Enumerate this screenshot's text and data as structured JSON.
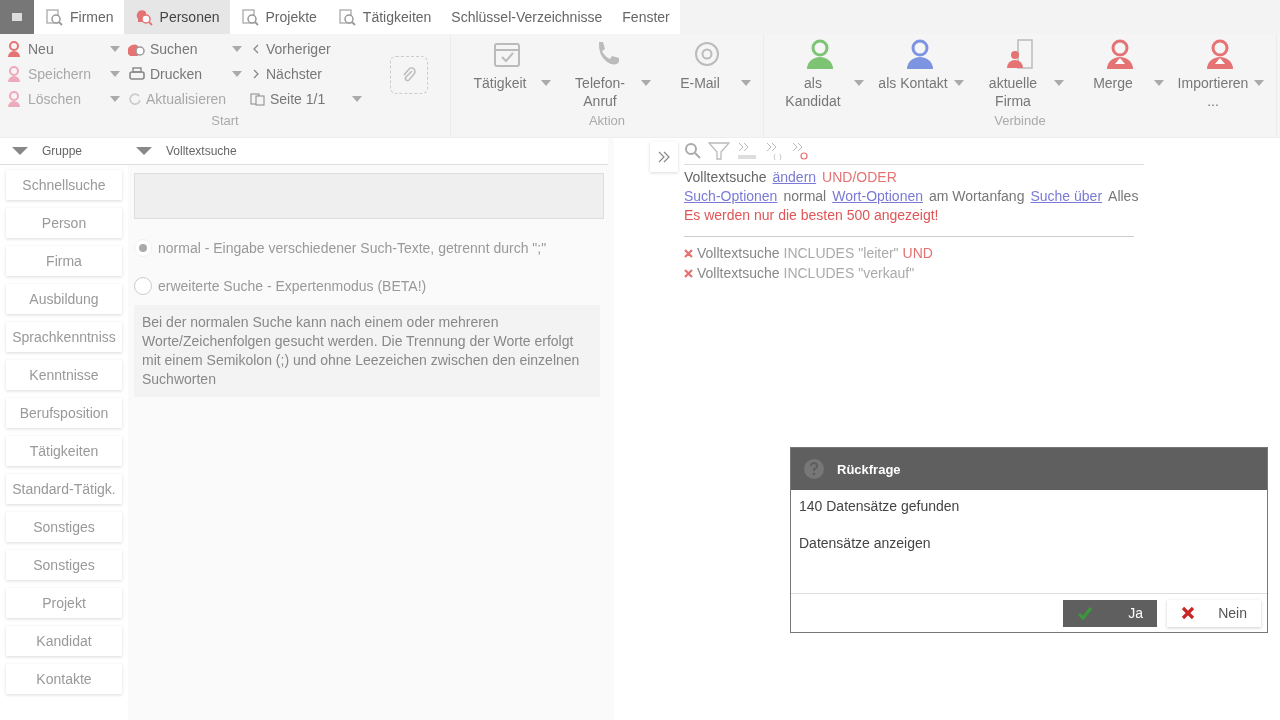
{
  "menu_tabs": [
    {
      "label": "Firmen",
      "kind": "icon",
      "selected": false
    },
    {
      "label": "Personen",
      "kind": "icon",
      "selected": true
    },
    {
      "label": "Projekte",
      "kind": "icon",
      "selected": false
    },
    {
      "label": "Tätigkeiten",
      "kind": "icon",
      "selected": false
    },
    {
      "label": "Schlüssel-Verzeichnisse",
      "kind": "plain",
      "selected": false
    },
    {
      "label": "Fenster",
      "kind": "plain",
      "selected": false
    }
  ],
  "ribbon": {
    "start": {
      "label": "Start",
      "columns": [
        [
          {
            "label": "Neu",
            "disabled": false,
            "dropdown": true
          },
          {
            "label": "Speichern",
            "disabled": true,
            "dropdown": true
          },
          {
            "label": "Löschen",
            "disabled": true,
            "dropdown": true
          }
        ],
        [
          {
            "label": "Suchen",
            "disabled": false,
            "dropdown": true
          },
          {
            "label": "Drucken",
            "disabled": false,
            "dropdown": true
          },
          {
            "label": "Aktualisieren",
            "disabled": true,
            "dropdown": false
          }
        ],
        [
          {
            "label": "Vorheriger",
            "disabled": false,
            "dropdown": false
          },
          {
            "label": "Nächster",
            "disabled": false,
            "dropdown": false
          },
          {
            "label": "Seite 1/1",
            "disabled": false,
            "dropdown": true
          }
        ]
      ]
    },
    "groups": [
      {
        "label": "Aktion",
        "buttons": [
          {
            "label": "Tätigkeit"
          },
          {
            "label": "Telefon-Anruf"
          },
          {
            "label": "E-Mail"
          }
        ]
      },
      {
        "label": "Verbinde",
        "buttons": [
          {
            "label": "als Kandidat"
          },
          {
            "label": "als Kontakt"
          },
          {
            "label": "aktuelle Firma"
          },
          {
            "label": "Merge"
          },
          {
            "label": "Importieren..."
          }
        ]
      }
    ]
  },
  "group_panel": {
    "title": "Gruppe",
    "items": [
      "Schnellsuche",
      "Person",
      "Firma",
      "Ausbildung",
      "Sprachkenntniss",
      "Kenntnisse",
      "Berufsposition",
      "Tätigkeiten",
      "Standard-Tätigk.",
      "Sonstiges",
      "Sonstiges",
      "Projekt",
      "Kandidat",
      "Kontakte"
    ]
  },
  "search_panel": {
    "title": "Volltextsuche",
    "modes": [
      {
        "label": "normal - Eingabe verschiedener Such-Texte, getrennt durch \";\"",
        "selected": true
      },
      {
        "label": "erweiterte Suche - Expertenmodus (BETA!)",
        "selected": false
      }
    ],
    "description": "Bei der normalen Suche kann nach einem oder mehreren Worte/Zeichenfolgen gesucht werden. Die Trennung der Worte erfolgt mit einem Semikolon (;) und ohne Leezeichen zwischen den einzelnen Suchworten"
  },
  "criteria": {
    "heading": "Volltextsuche",
    "change_link": "ändern",
    "operator": "UND/ODER",
    "options": [
      {
        "link": "Such-Optionen",
        "value": "normal"
      },
      {
        "link": "Wort-Optionen",
        "value": "am Wortanfang"
      },
      {
        "link": "Suche über",
        "value": "Alles"
      }
    ],
    "warning": "Es werden nur die besten 500 angezeigt!",
    "conditions": [
      {
        "field": "Volltextsuche",
        "op": "INCLUDES",
        "value": "\"leiter\"",
        "joiner": "UND"
      },
      {
        "field": "Volltextsuche",
        "op": "INCLUDES",
        "value": "\"verkauf\""
      }
    ]
  },
  "dialog": {
    "title": "Rückfrage",
    "messages": [
      "140 Datensätze gefunden",
      "Datensätze anzeigen"
    ],
    "buttons": [
      {
        "label": "Ja",
        "kind": "confirm"
      },
      {
        "label": "Nein",
        "kind": "cancel"
      }
    ]
  }
}
